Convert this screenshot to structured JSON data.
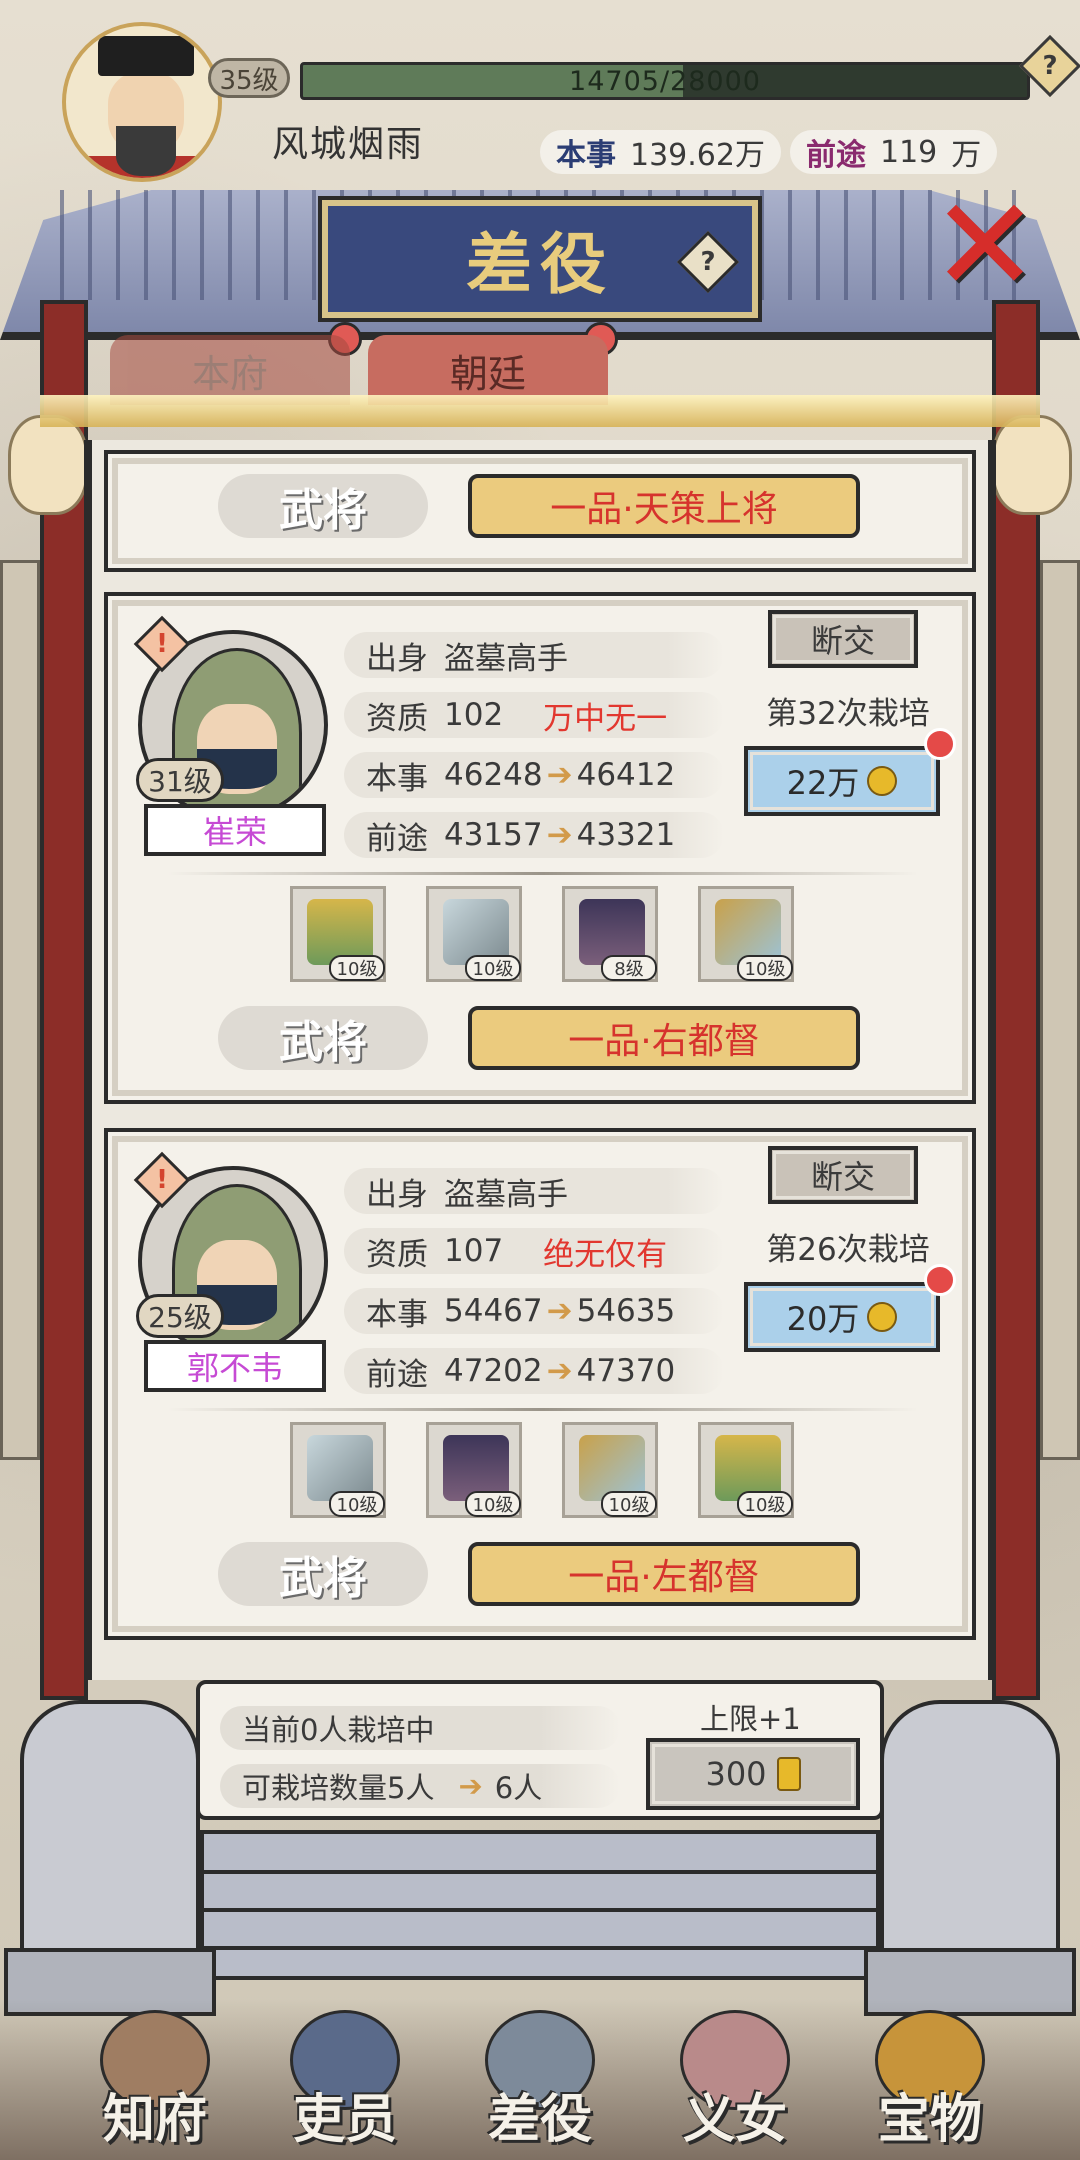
{
  "player": {
    "level": "35级",
    "xp_text": "14705/28000",
    "xp_fraction": 0.525,
    "name": "风城烟雨",
    "ability_label": "本事",
    "ability_value": "139.62万",
    "prospect_label": "前途",
    "prospect_value": "119",
    "prospect_unit": "万",
    "help": "?"
  },
  "header": {
    "title": "差役",
    "help": "?",
    "close": "✕"
  },
  "tabs": [
    {
      "label": "本府"
    },
    {
      "label": "朝廷"
    }
  ],
  "top_card": {
    "role": "武将",
    "rank": "一品·天策上将"
  },
  "cards": [
    {
      "level": "31级",
      "name": "崔荣",
      "origin_label": "出身",
      "origin": "盗墓高手",
      "aptitude_label": "资质",
      "aptitude": "102",
      "aptitude_grade": "万中无一",
      "ability_label": "本事",
      "ability_from": "46248",
      "ability_to": "46412",
      "prospect_label": "前途",
      "prospect_from": "43157",
      "prospect_to": "43321",
      "break_label": "断交",
      "cultivate_count": "第32次栽培",
      "cost": "22万",
      "equipment": [
        {
          "icon": "armor-icon",
          "level": "10级"
        },
        {
          "icon": "weapons-icon",
          "level": "10级"
        },
        {
          "icon": "horse-icon",
          "level": "8级"
        },
        {
          "icon": "sword-icon",
          "level": "10级"
        }
      ],
      "role": "武将",
      "rank": "一品·右都督"
    },
    {
      "level": "25级",
      "name": "郭不韦",
      "origin_label": "出身",
      "origin": "盗墓高手",
      "aptitude_label": "资质",
      "aptitude": "107",
      "aptitude_grade": "绝无仅有",
      "ability_label": "本事",
      "ability_from": "54467",
      "ability_to": "54635",
      "prospect_label": "前途",
      "prospect_from": "47202",
      "prospect_to": "47370",
      "break_label": "断交",
      "cultivate_count": "第26次栽培",
      "cost": "20万",
      "equipment": [
        {
          "icon": "weapons-icon",
          "level": "10级"
        },
        {
          "icon": "horse-icon",
          "level": "10级"
        },
        {
          "icon": "sword-icon",
          "level": "10级"
        },
        {
          "icon": "armor-icon",
          "level": "10级"
        }
      ],
      "role": "武将",
      "rank": "一品·左都督"
    }
  ],
  "summary": {
    "current": "当前0人栽培中",
    "capacity": "可栽培数量5人",
    "capacity_next": "6人",
    "limit_label": "上限+1",
    "limit_cost": "300"
  },
  "nav": [
    {
      "label": "知府"
    },
    {
      "label": "吏员"
    },
    {
      "label": "差役"
    },
    {
      "label": "义女"
    },
    {
      "label": "宝物"
    }
  ],
  "colors": {
    "accent_red": "#d6332d",
    "name_purple": "#c64ad4",
    "rank_gold": "#ebcb7e",
    "cost_blue": "#abd0ea",
    "plaque_blue": "#39497d"
  }
}
